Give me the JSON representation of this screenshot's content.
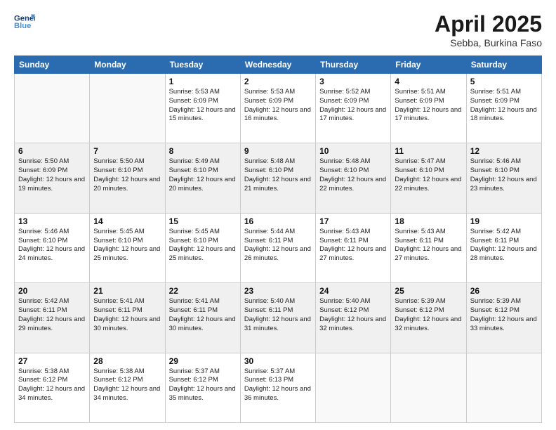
{
  "header": {
    "logo_line1": "General",
    "logo_line2": "Blue",
    "title": "April 2025",
    "subtitle": "Sebba, Burkina Faso"
  },
  "weekdays": [
    "Sunday",
    "Monday",
    "Tuesday",
    "Wednesday",
    "Thursday",
    "Friday",
    "Saturday"
  ],
  "weeks": [
    [
      {
        "day": "",
        "info": ""
      },
      {
        "day": "",
        "info": ""
      },
      {
        "day": "1",
        "info": "Sunrise: 5:53 AM\nSunset: 6:09 PM\nDaylight: 12 hours and 15 minutes."
      },
      {
        "day": "2",
        "info": "Sunrise: 5:53 AM\nSunset: 6:09 PM\nDaylight: 12 hours and 16 minutes."
      },
      {
        "day": "3",
        "info": "Sunrise: 5:52 AM\nSunset: 6:09 PM\nDaylight: 12 hours and 17 minutes."
      },
      {
        "day": "4",
        "info": "Sunrise: 5:51 AM\nSunset: 6:09 PM\nDaylight: 12 hours and 17 minutes."
      },
      {
        "day": "5",
        "info": "Sunrise: 5:51 AM\nSunset: 6:09 PM\nDaylight: 12 hours and 18 minutes."
      }
    ],
    [
      {
        "day": "6",
        "info": "Sunrise: 5:50 AM\nSunset: 6:09 PM\nDaylight: 12 hours and 19 minutes."
      },
      {
        "day": "7",
        "info": "Sunrise: 5:50 AM\nSunset: 6:10 PM\nDaylight: 12 hours and 20 minutes."
      },
      {
        "day": "8",
        "info": "Sunrise: 5:49 AM\nSunset: 6:10 PM\nDaylight: 12 hours and 20 minutes."
      },
      {
        "day": "9",
        "info": "Sunrise: 5:48 AM\nSunset: 6:10 PM\nDaylight: 12 hours and 21 minutes."
      },
      {
        "day": "10",
        "info": "Sunrise: 5:48 AM\nSunset: 6:10 PM\nDaylight: 12 hours and 22 minutes."
      },
      {
        "day": "11",
        "info": "Sunrise: 5:47 AM\nSunset: 6:10 PM\nDaylight: 12 hours and 22 minutes."
      },
      {
        "day": "12",
        "info": "Sunrise: 5:46 AM\nSunset: 6:10 PM\nDaylight: 12 hours and 23 minutes."
      }
    ],
    [
      {
        "day": "13",
        "info": "Sunrise: 5:46 AM\nSunset: 6:10 PM\nDaylight: 12 hours and 24 minutes."
      },
      {
        "day": "14",
        "info": "Sunrise: 5:45 AM\nSunset: 6:10 PM\nDaylight: 12 hours and 25 minutes."
      },
      {
        "day": "15",
        "info": "Sunrise: 5:45 AM\nSunset: 6:10 PM\nDaylight: 12 hours and 25 minutes."
      },
      {
        "day": "16",
        "info": "Sunrise: 5:44 AM\nSunset: 6:11 PM\nDaylight: 12 hours and 26 minutes."
      },
      {
        "day": "17",
        "info": "Sunrise: 5:43 AM\nSunset: 6:11 PM\nDaylight: 12 hours and 27 minutes."
      },
      {
        "day": "18",
        "info": "Sunrise: 5:43 AM\nSunset: 6:11 PM\nDaylight: 12 hours and 27 minutes."
      },
      {
        "day": "19",
        "info": "Sunrise: 5:42 AM\nSunset: 6:11 PM\nDaylight: 12 hours and 28 minutes."
      }
    ],
    [
      {
        "day": "20",
        "info": "Sunrise: 5:42 AM\nSunset: 6:11 PM\nDaylight: 12 hours and 29 minutes."
      },
      {
        "day": "21",
        "info": "Sunrise: 5:41 AM\nSunset: 6:11 PM\nDaylight: 12 hours and 30 minutes."
      },
      {
        "day": "22",
        "info": "Sunrise: 5:41 AM\nSunset: 6:11 PM\nDaylight: 12 hours and 30 minutes."
      },
      {
        "day": "23",
        "info": "Sunrise: 5:40 AM\nSunset: 6:11 PM\nDaylight: 12 hours and 31 minutes."
      },
      {
        "day": "24",
        "info": "Sunrise: 5:40 AM\nSunset: 6:12 PM\nDaylight: 12 hours and 32 minutes."
      },
      {
        "day": "25",
        "info": "Sunrise: 5:39 AM\nSunset: 6:12 PM\nDaylight: 12 hours and 32 minutes."
      },
      {
        "day": "26",
        "info": "Sunrise: 5:39 AM\nSunset: 6:12 PM\nDaylight: 12 hours and 33 minutes."
      }
    ],
    [
      {
        "day": "27",
        "info": "Sunrise: 5:38 AM\nSunset: 6:12 PM\nDaylight: 12 hours and 34 minutes."
      },
      {
        "day": "28",
        "info": "Sunrise: 5:38 AM\nSunset: 6:12 PM\nDaylight: 12 hours and 34 minutes."
      },
      {
        "day": "29",
        "info": "Sunrise: 5:37 AM\nSunset: 6:12 PM\nDaylight: 12 hours and 35 minutes."
      },
      {
        "day": "30",
        "info": "Sunrise: 5:37 AM\nSunset: 6:13 PM\nDaylight: 12 hours and 36 minutes."
      },
      {
        "day": "",
        "info": ""
      },
      {
        "day": "",
        "info": ""
      },
      {
        "day": "",
        "info": ""
      }
    ]
  ]
}
